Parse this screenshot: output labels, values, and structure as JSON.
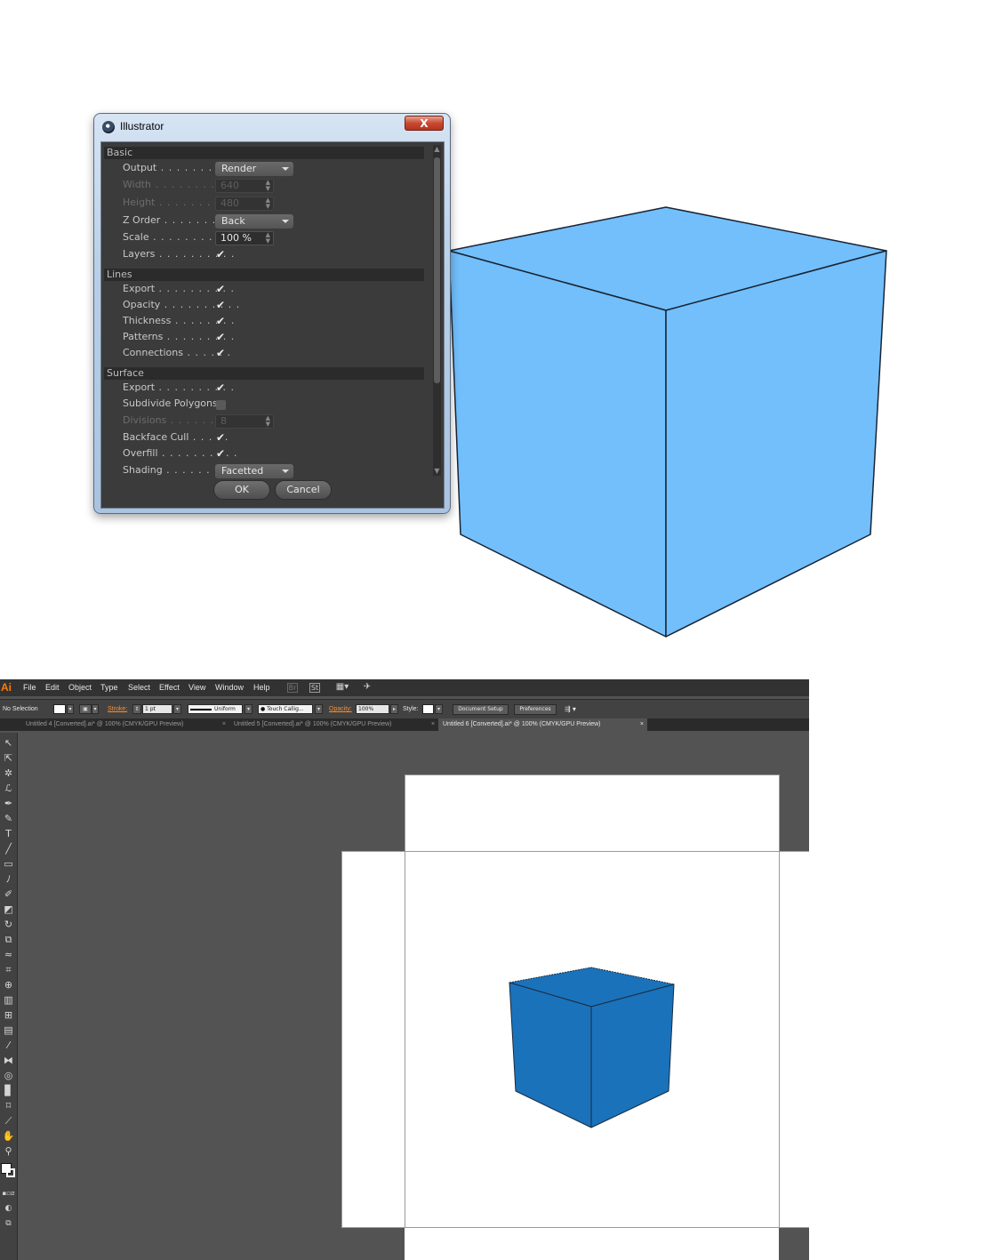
{
  "dialog": {
    "title": "Illustrator",
    "close_label": "X",
    "sections": {
      "basic": "Basic",
      "lines": "Lines",
      "surface": "Surface"
    },
    "basic": {
      "output_label": "Output",
      "output_value": "Render",
      "width_label": "Width",
      "width_value": "640",
      "height_label": "Height",
      "height_value": "480",
      "zorder_label": "Z Order",
      "zorder_value": "Back",
      "scale_label": "Scale",
      "scale_value": "100 %",
      "layers_label": "Layers",
      "layers_checked": true
    },
    "lines": {
      "export_label": "Export",
      "export_checked": true,
      "opacity_label": "Opacity",
      "opacity_checked": true,
      "thickness_label": "Thickness",
      "thickness_checked": true,
      "patterns_label": "Patterns",
      "patterns_checked": true,
      "connections_label": "Connections",
      "connections_checked": true
    },
    "surface": {
      "export_label": "Export",
      "export_checked": true,
      "subdivide_label": "Subdivide Polygons",
      "subdivide_checked": false,
      "divisions_label": "Divisions",
      "divisions_value": "8",
      "backface_label": "Backface Cull",
      "backface_checked": true,
      "overfill_label": "Overfill",
      "overfill_checked": true,
      "shading_label": "Shading",
      "shading_value": "Facetted"
    },
    "ok_label": "OK",
    "cancel_label": "Cancel",
    "checkmark": "✔"
  },
  "illustrator": {
    "logo": "Ai",
    "menu": [
      "File",
      "Edit",
      "Object",
      "Type",
      "Select",
      "Effect",
      "View",
      "Window",
      "Help"
    ],
    "menu_icons": [
      "Br",
      "St"
    ],
    "control_bar": {
      "selection": "No Selection",
      "stroke_label": "Stroke:",
      "stroke_value": "1 pt",
      "profile": "Uniform",
      "brush": "Touch Callig...",
      "opacity_label": "Opacity:",
      "opacity_value": "100%",
      "style_label": "Style:",
      "document_setup": "Document Setup",
      "preferences": "Preferences"
    },
    "tabs": [
      {
        "label": "Untitled 4 [Converted].ai* @ 100% (CMYK/GPU Preview)",
        "active": false
      },
      {
        "label": "Untitled 5 [Converted].ai* @ 100% (CMYK/GPU Preview)",
        "active": false
      },
      {
        "label": "Untitled 6 [Converted].ai* @ 100% (CMYK/GPU Preview)",
        "active": true
      }
    ],
    "tab_close": "×"
  },
  "colors": {
    "large_cube_fill": "#72bffc",
    "small_cube_fill": "#1a72bb",
    "outline": "#1a2433"
  }
}
